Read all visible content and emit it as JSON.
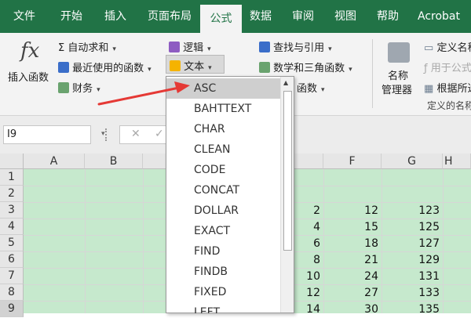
{
  "ribbon_tabs": [
    "文件",
    "开始",
    "插入",
    "页面布局",
    "公式",
    "数据",
    "审阅",
    "视图",
    "帮助",
    "Acrobat"
  ],
  "active_tab": "公式",
  "ribbon": {
    "insert_function": {
      "symbol": "fx",
      "label": "插入函数"
    },
    "autosum": "自动求和",
    "recent": "最近使用的函数",
    "financial": "财务",
    "logical": "逻辑",
    "text": "文本",
    "lookup": "查找与引用",
    "math": "数学和三角函数",
    "more_functions": "函数",
    "name_manager_line1": "名称",
    "name_manager_line2": "管理器",
    "define_name": "定义名称",
    "use_in_formula": "用于公式",
    "create_from_selection": "根据所选",
    "group_label": "定义的名称"
  },
  "formula_bar": {
    "name_box": "I9",
    "cancel_glyph": "✕",
    "enter_glyph": "✓"
  },
  "columns": [
    "A",
    "B",
    "F",
    "G",
    "H"
  ],
  "rows": [
    "1",
    "2",
    "3",
    "4",
    "5",
    "6",
    "7",
    "8",
    "9"
  ],
  "grid": {
    "col_e_partial": [
      "2",
      "4",
      "6",
      "8",
      "10",
      "12",
      "14"
    ],
    "col_f": [
      "12",
      "15",
      "18",
      "21",
      "24",
      "27",
      "30"
    ],
    "col_g": [
      "123",
      "125",
      "127",
      "129",
      "131",
      "133",
      "135"
    ]
  },
  "dropdown": {
    "items": [
      "ASC",
      "BAHTTEXT",
      "CHAR",
      "CLEAN",
      "CODE",
      "CONCAT",
      "DOLLAR",
      "EXACT",
      "FIND",
      "FINDB",
      "FIXED",
      "LEFT"
    ],
    "highlighted": "ASC"
  },
  "colors": {
    "brand": "#217346",
    "selection_fill": "#c6e9cd",
    "arrow": "#e53935"
  }
}
